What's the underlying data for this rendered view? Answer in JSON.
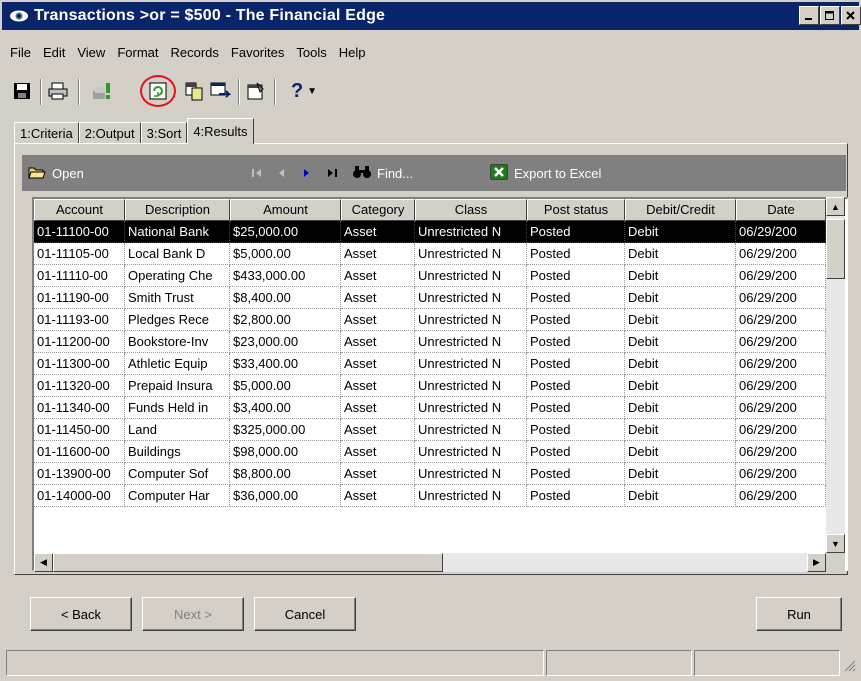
{
  "window": {
    "title": "Transactions >or = $500 - The Financial Edge"
  },
  "menu": [
    "File",
    "Edit",
    "View",
    "Format",
    "Records",
    "Favorites",
    "Tools",
    "Help"
  ],
  "toolbar": {
    "buttons": [
      "save-icon",
      "print-icon",
      "criteria-icon",
      "refresh-icon",
      "copy-icon",
      "export-icon",
      "properties-icon",
      "help-icon"
    ],
    "help_dropdown": "?"
  },
  "tabs": [
    {
      "label": "1:Criteria"
    },
    {
      "label": "2:Output"
    },
    {
      "label": "3:Sort"
    },
    {
      "label": "4:Results",
      "active": true
    }
  ],
  "results_toolbar": {
    "open_label": "Open",
    "find_label": "Find...",
    "export_label": "Export to Excel"
  },
  "table": {
    "columns": [
      "Account",
      "Description",
      "Amount",
      "Category",
      "Class",
      "Post status",
      "Debit/Credit",
      "Date"
    ],
    "rows": [
      [
        "01-11100-00",
        "National Bank",
        "$25,000.00",
        "Asset",
        "Unrestricted N",
        "Posted",
        "Debit",
        "06/29/200"
      ],
      [
        "01-11105-00",
        "Local Bank D",
        "$5,000.00",
        "Asset",
        "Unrestricted N",
        "Posted",
        "Debit",
        "06/29/200"
      ],
      [
        "01-11110-00",
        "Operating Che",
        "$433,000.00",
        "Asset",
        "Unrestricted N",
        "Posted",
        "Debit",
        "06/29/200"
      ],
      [
        "01-11190-00",
        "Smith Trust",
        "$8,400.00",
        "Asset",
        "Unrestricted N",
        "Posted",
        "Debit",
        "06/29/200"
      ],
      [
        "01-11193-00",
        "Pledges Rece",
        "$2,800.00",
        "Asset",
        "Unrestricted N",
        "Posted",
        "Debit",
        "06/29/200"
      ],
      [
        "01-11200-00",
        "Bookstore-Inv",
        "$23,000.00",
        "Asset",
        "Unrestricted N",
        "Posted",
        "Debit",
        "06/29/200"
      ],
      [
        "01-11300-00",
        "Athletic Equip",
        "$33,400.00",
        "Asset",
        "Unrestricted N",
        "Posted",
        "Debit",
        "06/29/200"
      ],
      [
        "01-11320-00",
        "Prepaid Insura",
        "$5,000.00",
        "Asset",
        "Unrestricted N",
        "Posted",
        "Debit",
        "06/29/200"
      ],
      [
        "01-11340-00",
        "Funds Held in",
        "$3,400.00",
        "Asset",
        "Unrestricted N",
        "Posted",
        "Debit",
        "06/29/200"
      ],
      [
        "01-11450-00",
        "Land",
        "$325,000.00",
        "Asset",
        "Unrestricted N",
        "Posted",
        "Debit",
        "06/29/200"
      ],
      [
        "01-11600-00",
        "Buildings",
        "$98,000.00",
        "Asset",
        "Unrestricted N",
        "Posted",
        "Debit",
        "06/29/200"
      ],
      [
        "01-13900-00",
        "Computer Sof",
        "$8,800.00",
        "Asset",
        "Unrestricted N",
        "Posted",
        "Debit",
        "06/29/200"
      ],
      [
        "01-14000-00",
        "Computer Har",
        "$36,000.00",
        "Asset",
        "Unrestricted N",
        "Posted",
        "Debit",
        "06/29/200"
      ]
    ],
    "selected_row": 0
  },
  "buttons": {
    "back": "< Back",
    "next": "Next >",
    "cancel": "Cancel",
    "run": "Run"
  },
  "colors": {
    "titlebar": "#0a246a",
    "highlight_circle": "#e0141e",
    "results_bar": "#808080"
  }
}
